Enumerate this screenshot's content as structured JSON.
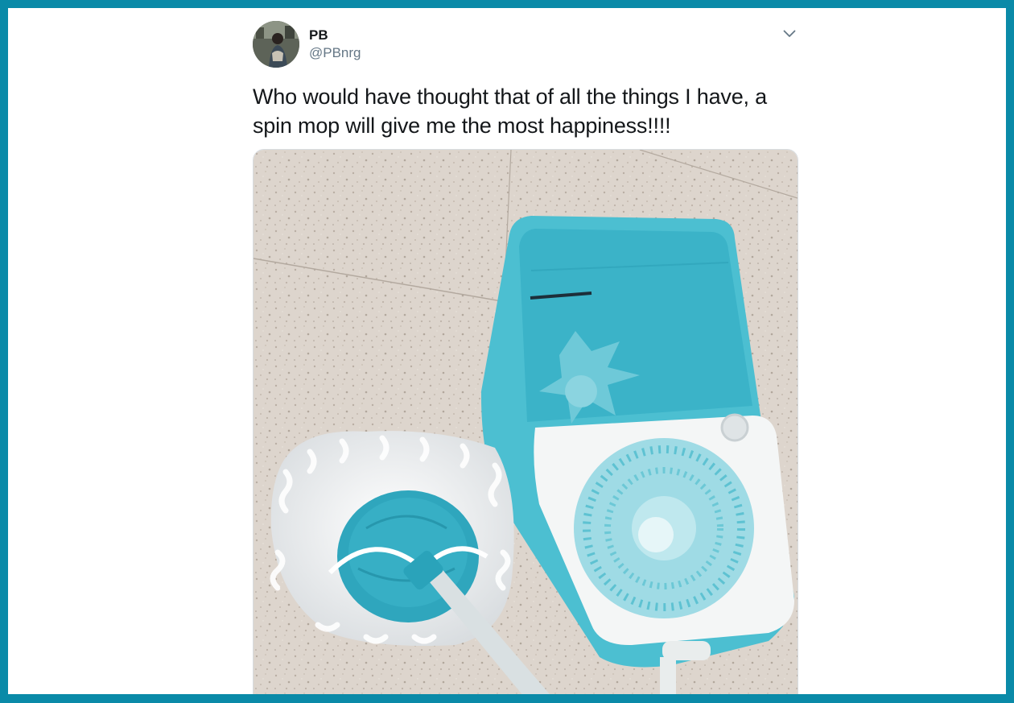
{
  "tweet": {
    "display_name": "PB",
    "handle": "@PBnrg",
    "text": "Who would have thought that of all the things I have, a spin mop will give me the most happiness!!!!",
    "avatar_icon": "user-avatar",
    "menu_icon": "chevron-down-icon",
    "media": {
      "kind": "photo",
      "icons": [
        "spin-mop-head",
        "spin-mop-bucket"
      ]
    }
  },
  "colors": {
    "frame_border": "#0a8aa8",
    "mop_teal": "#3cb4c8",
    "text": "#14171a",
    "secondary_text": "#657786"
  }
}
